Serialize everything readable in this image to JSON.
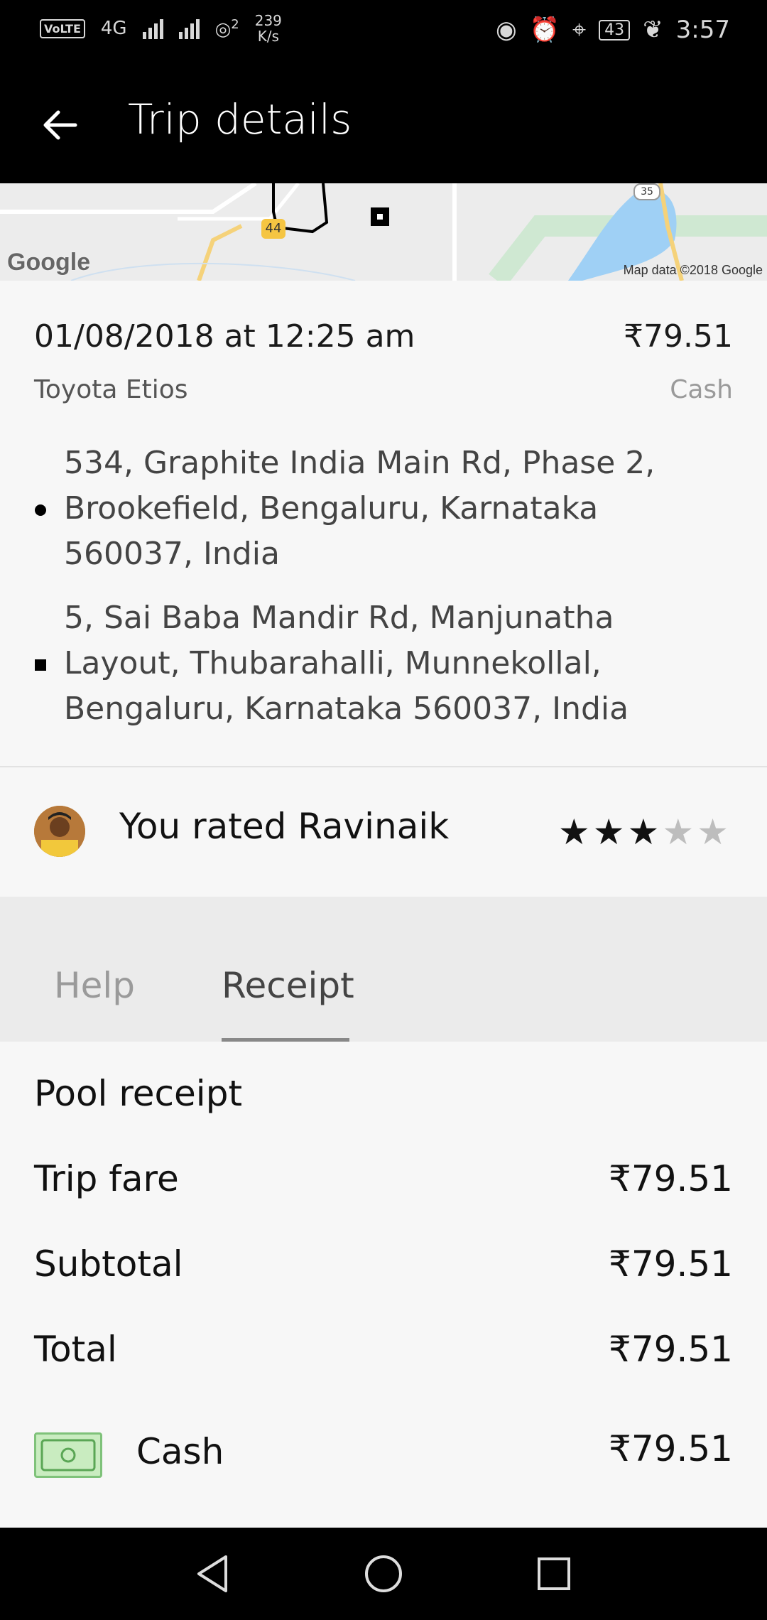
{
  "status_bar": {
    "volte": "VoLTE",
    "network": "4G",
    "speed_value": "239",
    "speed_unit": "K/s",
    "hotspot_clients": "2",
    "battery": "43",
    "time": "3:57"
  },
  "app_bar": {
    "title": "Trip details"
  },
  "map": {
    "credit": "Map data ©2018 Google",
    "logo": "Google",
    "route_badge_1": "44",
    "route_badge_2": "35"
  },
  "trip": {
    "date": "01/08/2018 at 12:25 am",
    "price": "₹79.51",
    "vehicle": "Toyota Etios",
    "payment": "Cash",
    "pickup_address": "534, Graphite India Main Rd, Phase 2, Brookefield, Bengaluru, Karnataka 560037, India",
    "dropoff_address": "5, Sai Baba Mandir Rd, Manjunatha Layout, Thubarahalli, Munnekollal, Bengaluru, Karnataka 560037, India"
  },
  "rating": {
    "text": "You rated Ravinaik",
    "stars": 3,
    "max_stars": 5
  },
  "tabs": {
    "help": "Help",
    "receipt": "Receipt",
    "active": "Receipt"
  },
  "receipt": {
    "title": "Pool receipt",
    "lines": [
      {
        "label": "Trip fare",
        "value": "₹79.51"
      },
      {
        "label": "Subtotal",
        "value": "₹79.51"
      },
      {
        "label": "Total",
        "value": "₹79.51"
      }
    ],
    "payment_label": "Cash",
    "payment_value": "₹79.51"
  },
  "colors": {
    "bar_bg": "#000000",
    "page_bg": "#f7f7f7",
    "tabs_bg": "#ebebeb",
    "cash_green": "#c9ecc0"
  }
}
